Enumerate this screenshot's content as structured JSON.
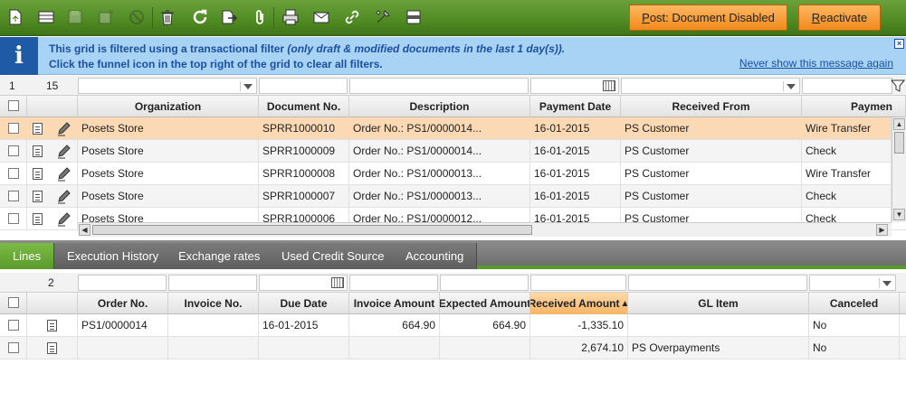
{
  "toolbar": {
    "icons": [
      "new-document-icon",
      "new-row-icon",
      "save-icon",
      "save-close-icon",
      "undo-icon",
      "delete-icon",
      "refresh-icon",
      "export-icon",
      "attachment-icon",
      "print-icon",
      "email-icon",
      "link-icon",
      "tools-icon",
      "grid-toggle-icon"
    ],
    "post_label": "Post: Document Disabled",
    "reactivate_label": "Reactivate"
  },
  "info": {
    "line1_prefix": "This grid is filtered using a transactional filter ",
    "line1_italic": "(only draft & modified documents in the last 1 day(s)).",
    "line2": "Click the funnel icon in the top right of the grid to clear all filters.",
    "never_show": "Never show this message again"
  },
  "top_grid": {
    "selected_count": "1",
    "total_count": "15",
    "columns": [
      "Organization",
      "Document No.",
      "Description",
      "Payment Date",
      "Received From",
      "Paymen"
    ],
    "rows": [
      {
        "org": "Posets Store",
        "doc": "SPRR1000010",
        "desc": "Order No.: PS1/0000014...",
        "date": "16-01-2015",
        "from": "PS Customer",
        "method": "Wire Transfer"
      },
      {
        "org": "Posets Store",
        "doc": "SPRR1000009",
        "desc": "Order No.: PS1/0000014...",
        "date": "16-01-2015",
        "from": "PS Customer",
        "method": "Check"
      },
      {
        "org": "Posets Store",
        "doc": "SPRR1000008",
        "desc": "Order No.: PS1/0000013...",
        "date": "16-01-2015",
        "from": "PS Customer",
        "method": "Wire Transfer"
      },
      {
        "org": "Posets Store",
        "doc": "SPRR1000007",
        "desc": "Order No.: PS1/0000013...",
        "date": "16-01-2015",
        "from": "PS Customer",
        "method": "Check"
      },
      {
        "org": "Posets Store",
        "doc": "SPRR1000006",
        "desc": "Order No.: PS1/0000012...",
        "date": "16-01-2015",
        "from": "PS Customer",
        "method": "Check"
      }
    ]
  },
  "tabs": [
    "Lines",
    "Execution History",
    "Exchange rates",
    "Used Credit Source",
    "Accounting"
  ],
  "lines_grid": {
    "total_count": "2",
    "columns": [
      "Order No.",
      "Invoice No.",
      "Due Date",
      "Invoice Amount",
      "Expected Amount",
      "Received Amount",
      "GL Item",
      "Canceled"
    ],
    "sort_indicator": "▲",
    "rows": [
      {
        "order": "PS1/0000014",
        "invoice": "",
        "due": "16-01-2015",
        "inv_amt": "664.90",
        "exp_amt": "664.90",
        "rec_amt": "-1,335.10",
        "gl": "",
        "canceled": "No"
      },
      {
        "order": "",
        "invoice": "",
        "due": "",
        "inv_amt": "",
        "exp_amt": "",
        "rec_amt": "2,674.10",
        "gl": "PS Overpayments",
        "canceled": "No"
      }
    ]
  },
  "colors": {
    "toolbar_green": "#4f8a22",
    "accent_orange": "#f08a1c",
    "info_blue": "#a9d3f5",
    "selected_row": "#fbd9b4"
  }
}
